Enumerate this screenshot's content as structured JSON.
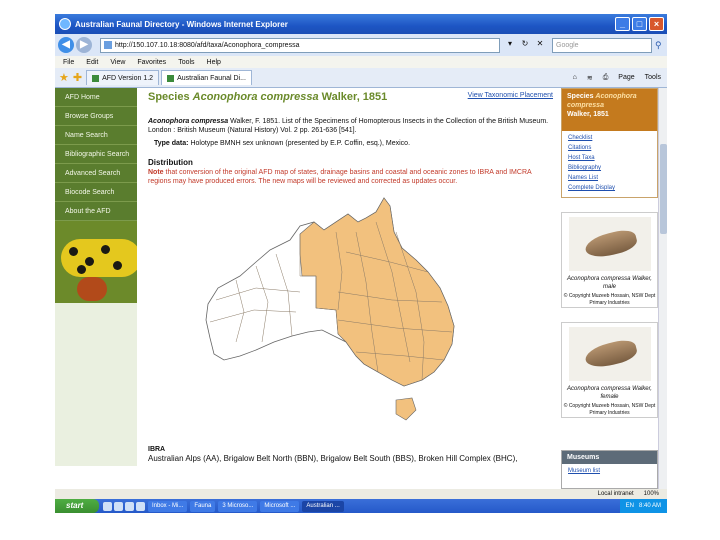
{
  "window": {
    "title": "Australian Faunal Directory - Windows Internet Explorer",
    "url": "http://150.107.10.18:8080/afd/taxa/Aconophora_compressa",
    "search_placeholder": "Google"
  },
  "menu": [
    "File",
    "Edit",
    "View",
    "Favorites",
    "Tools",
    "Help"
  ],
  "tabs": [
    {
      "label": "AFD Version 1.2"
    },
    {
      "label": "Australian Faunal Di..."
    }
  ],
  "toolbar": {
    "page_label": "Page",
    "tools_label": "Tools"
  },
  "nav": {
    "items": [
      "AFD Home",
      "Browse Groups",
      "Name Search",
      "Bibliographic Search",
      "Advanced Search",
      "Biocode Search",
      "About the AFD"
    ]
  },
  "main": {
    "title_prefix": "Species",
    "title_name": "Aconophora compressa",
    "title_author": "Walker, 1851",
    "tax_link": "View Taxonomic Placement",
    "reference_name": "Aconophora compressa",
    "reference_text": "Walker, F. 1851. List of the Specimens of Homopterous Insects in the Collection of the British Museum. London : British Museum (Natural History) Vol. 2 pp. 261-636 [541].",
    "type_label": "Type data:",
    "type_text": "Holotype BMNH sex unknown (presented by E.P. Coffin, esq.), Mexico.",
    "distribution_heading": "Distribution",
    "note_label": "Note",
    "note_text": "that conversion of the original AFD map of states, drainage basins and coastal and oceanic zones to IBRA and IMCRA regions may have produced errors. The new maps will be reviewed and corrected as updates occur.",
    "ibra_heading": "IBRA",
    "ibra_text": "Australian Alps (AA), Brigalow Belt North (BBN), Brigalow Belt South (BBS), Broken Hill Complex (BHC),"
  },
  "sidebar": {
    "species_label": "Species",
    "species_name": "Aconophora compressa",
    "species_author": "Walker, 1851",
    "links": [
      "Checklist",
      "Citations",
      "Host Taxa",
      "Bibliography",
      "Names List",
      "Complete Display"
    ],
    "images": [
      {
        "caption": "Aconophora compressa Walker, male",
        "copyright": "© Copyright Muzeeb Hossain, NSW Dept Primary Industries"
      },
      {
        "caption": "Aconophora compressa Walker, female",
        "copyright": "© Copyright Muzeeb Hossain, NSW Dept Primary Industries"
      }
    ],
    "museums_heading": "Museums",
    "museums_link": "Museum list"
  },
  "status": {
    "zone": "Local intranet",
    "zoom": "100%"
  },
  "taskbar": {
    "start": "start",
    "tasks": [
      "Inbox - Mi...",
      "Fauna",
      "3 Microso...",
      "Microsoft ...",
      "Australian ..."
    ],
    "lang": "EN",
    "time": "8:40 AM"
  },
  "colors": {
    "nav_green": "#5a7d2e",
    "title_green": "#6a8a2a",
    "map_fill": "#f2c17e",
    "sidebar_orange": "#c47a1e",
    "note_red": "#c23a2a"
  }
}
